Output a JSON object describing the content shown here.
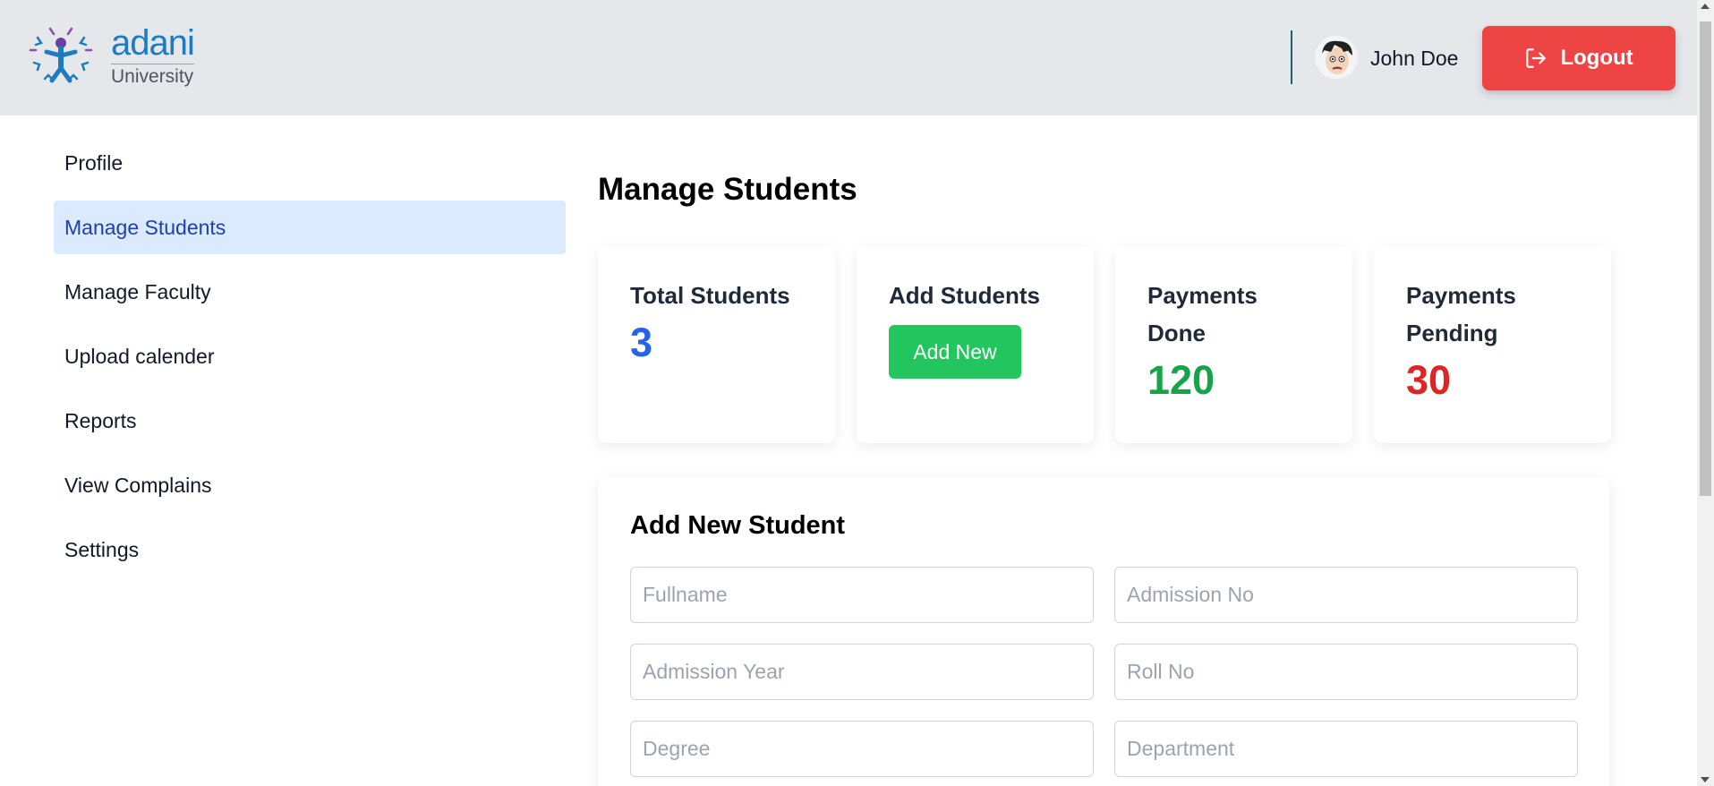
{
  "header": {
    "logo_brand": "adani",
    "logo_sub": "University",
    "user_name": "John Doe",
    "logout_label": "Logout"
  },
  "sidebar": {
    "items": [
      {
        "label": "Profile",
        "active": false
      },
      {
        "label": "Manage Students",
        "active": true
      },
      {
        "label": "Manage Faculty",
        "active": false
      },
      {
        "label": "Upload calender",
        "active": false
      },
      {
        "label": "Reports",
        "active": false
      },
      {
        "label": "View Complains",
        "active": false
      },
      {
        "label": "Settings",
        "active": false
      }
    ]
  },
  "main": {
    "title": "Manage Students",
    "cards": {
      "total": {
        "title": "Total Students",
        "value": "3",
        "color": "#2563eb"
      },
      "add": {
        "title": "Add Students",
        "button_label": "Add New",
        "button_color": "#22c55e"
      },
      "done": {
        "title": "Payments Done",
        "value": "120",
        "color": "#16a34a"
      },
      "pending": {
        "title": "Payments Pending",
        "value": "30",
        "color": "#dc2626"
      }
    },
    "form": {
      "title": "Add New Student",
      "fields": {
        "fullname": {
          "placeholder": "Fullname",
          "value": ""
        },
        "admission_no": {
          "placeholder": "Admission No",
          "value": ""
        },
        "admission_year": {
          "placeholder": "Admission Year",
          "value": ""
        },
        "roll_no": {
          "placeholder": "Roll No",
          "value": ""
        },
        "degree": {
          "placeholder": "Degree",
          "value": ""
        },
        "department": {
          "placeholder": "Department",
          "value": ""
        }
      }
    }
  },
  "colors": {
    "header_bg": "#e5e7eb",
    "logout": "#ef4444",
    "active_nav_bg": "#dbeafe",
    "active_nav_text": "#1e40af"
  },
  "icons": [
    "logo-mark",
    "avatar",
    "logout-icon"
  ]
}
